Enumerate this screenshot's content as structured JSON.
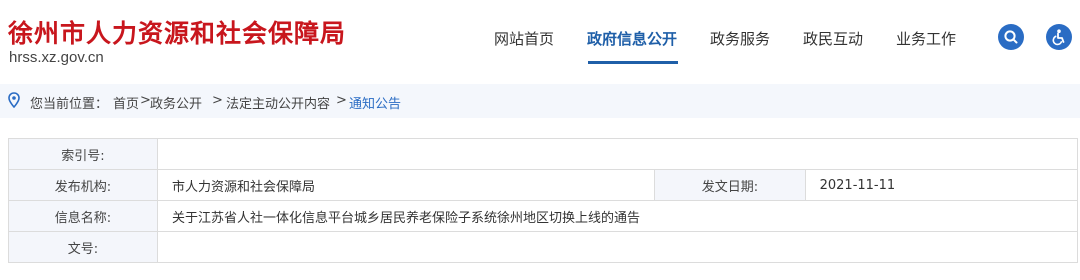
{
  "header": {
    "site_title": "徐州市人力资源和社会保障局",
    "site_domain": "hrss.xz.gov.cn",
    "nav": [
      "网站首页",
      "政府信息公开",
      "政务服务",
      "政民互动",
      "业务工作"
    ],
    "active_nav": "政府信息公开",
    "accent_color": "#1f5fa8",
    "title_color": "#c8161d",
    "icons": [
      "search-icon",
      "accessibility-icon"
    ]
  },
  "breadcrumb": {
    "prefix": "您当前位置：",
    "items": [
      "首页",
      "政务公开",
      "法定主动公开内容",
      "通知公告"
    ],
    "separators": [
      ">",
      ">",
      ">"
    ]
  },
  "info_table": {
    "index_label": "索引号:",
    "index_value": "",
    "publisher_label": "发布机构:",
    "publisher_value": "市人力资源和社会保障局",
    "date_label": "发文日期:",
    "date_value": "2021-11-11",
    "name_label": "信息名称:",
    "name_value": "关于江苏省人社一体化信息平台城乡居民养老保险子系统徐州地区切换上线的通告",
    "doc_no_label": "文号:",
    "doc_no_value": ""
  }
}
